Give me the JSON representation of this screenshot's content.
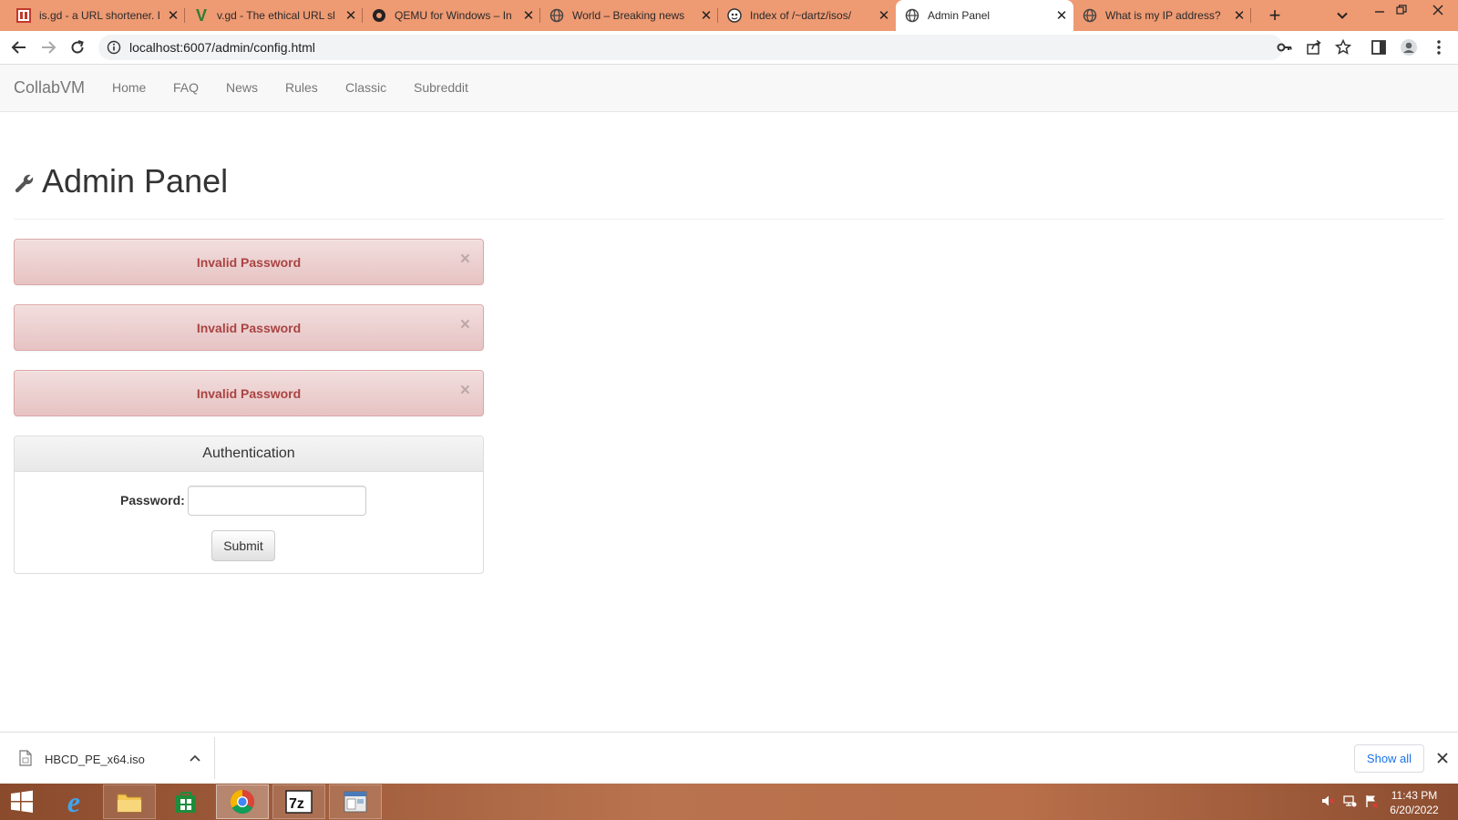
{
  "browser": {
    "tabs": [
      {
        "title": "is.gd - a URL shortener. I",
        "icon": "isgd-icon",
        "active": false
      },
      {
        "title": "v.gd - The ethical URL sl",
        "icon": "vgd-icon",
        "active": false
      },
      {
        "title": "QEMU for Windows – In",
        "icon": "qemu-icon",
        "active": false
      },
      {
        "title": "World – Breaking news",
        "icon": "globe-icon",
        "active": false
      },
      {
        "title": "Index of /~dartz/isos/",
        "icon": "index-icon",
        "active": false
      },
      {
        "title": "Admin Panel",
        "icon": "globe-icon",
        "active": true
      },
      {
        "title": "What is my IP address?",
        "icon": "globe-icon",
        "active": false
      }
    ],
    "url": "localhost:6007/admin/config.html"
  },
  "navbar": {
    "brand": "CollabVM",
    "links": [
      "Home",
      "FAQ",
      "News",
      "Rules",
      "Classic",
      "Subreddit"
    ]
  },
  "page": {
    "title": "Admin Panel",
    "alerts": [
      "Invalid Password",
      "Invalid Password",
      "Invalid Password"
    ],
    "alert_close": "×",
    "auth_panel": {
      "heading": "Authentication",
      "password_label": "Password:",
      "password_value": "",
      "submit_label": "Submit"
    }
  },
  "downloads": {
    "file_name": "HBCD_PE_x64.iso",
    "show_all_label": "Show all"
  },
  "taskbar": {
    "time": "11:43 PM",
    "date": "6/20/2022"
  },
  "colors": {
    "tabstrip": "#ee9a73",
    "alert_text": "#a94442",
    "link_blue": "#1a73e8"
  }
}
